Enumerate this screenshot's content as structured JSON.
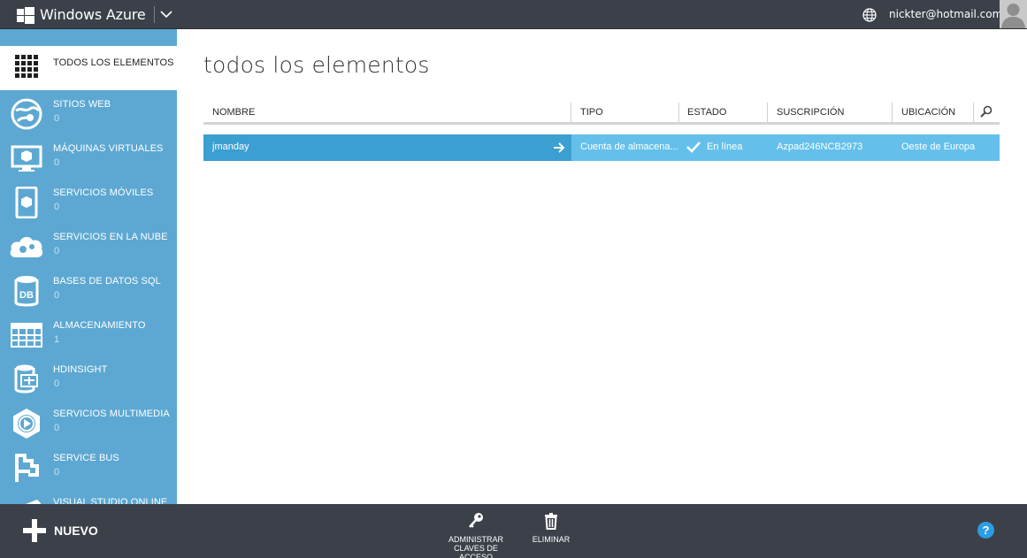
{
  "header": {
    "app_title": "Windows Azure",
    "user_email": "nickter@hotmail.com",
    "icons": [
      "windows-logo-icon",
      "chevron-down-icon",
      "globe-icon",
      "avatar"
    ]
  },
  "sidebar": {
    "items": [
      {
        "label": "TODOS LOS ELEMENTOS",
        "count": "",
        "icon": "grid-icon"
      },
      {
        "label": "SITIOS WEB",
        "count": "0",
        "icon": "websites-icon"
      },
      {
        "label": "MÁQUINAS VIRTUALES",
        "count": "0",
        "icon": "virtual-machine-icon"
      },
      {
        "label": "SERVICIOS MÓVILES",
        "count": "0",
        "icon": "mobile-services-icon"
      },
      {
        "label": "SERVICIOS EN LA NUBE",
        "count": "0",
        "icon": "cloud-services-icon"
      },
      {
        "label": "BASES DE DATOS SQL",
        "count": "0",
        "icon": "sql-database-icon"
      },
      {
        "label": "ALMACENAMIENTO",
        "count": "1",
        "icon": "storage-icon"
      },
      {
        "label": "HDINSIGHT",
        "count": "0",
        "icon": "hdinsight-icon"
      },
      {
        "label": "SERVICIOS MULTIMEDIA",
        "count": "0",
        "icon": "media-services-icon"
      },
      {
        "label": "SERVICE BUS",
        "count": "0",
        "icon": "service-bus-icon"
      },
      {
        "label": "VISUAL STUDIO ONLINE",
        "count": "",
        "icon": "visual-studio-icon"
      }
    ]
  },
  "main": {
    "title": "todos los elementos",
    "columns": [
      "NOMBRE",
      "TIPO",
      "ESTADO",
      "SUSCRIPCIÓN",
      "UBICACIÓN"
    ],
    "rows": [
      {
        "nombre": "jmanday",
        "tipo": "Cuenta de almacena...",
        "estado": "En línea",
        "suscripcion": "Azpad246NCB2973",
        "ubicacion": "Oeste de Europa"
      }
    ]
  },
  "footer": {
    "new_label": "NUEVO",
    "manage_keys_label": "ADMINISTRAR CLAVES DE ACCESO",
    "delete_label": "ELIMINAR",
    "help_label": "?"
  },
  "colors": {
    "topbar": "#3c4049",
    "sidebar": "#5da8d2",
    "row_selected": "#64c0ea",
    "row_name": "#3c9fd2",
    "help": "#2b9de5"
  }
}
